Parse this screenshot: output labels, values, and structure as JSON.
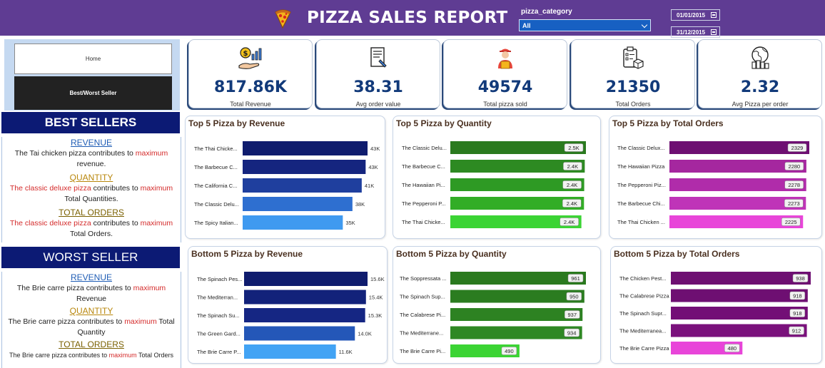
{
  "header": {
    "title": "PIZZA SALES REPORT",
    "category_label": "pizza_category",
    "category_value": "All",
    "date_start": "01/01/2015",
    "date_end": "31/12/2015",
    "bg_color": "#5f3c93"
  },
  "nav": {
    "home_label": "Home",
    "best_worst_label": "Best/Worst Seller"
  },
  "best": {
    "title": "BEST SELLERS",
    "revenue_head": "REVENUE",
    "revenue_pre": "The Tai chicken pizza contributes to ",
    "revenue_hl": "maximum",
    "revenue_post": " revenue.",
    "quantity_head": "QUANTITY",
    "quantity_name": "The classic deluxe pizza",
    "quantity_mid": " contributes to ",
    "quantity_hl": "maximum",
    "quantity_post": " Total Quantities.",
    "orders_head": "TOTAL ORDERS",
    "orders_name": "The classic deluxe pizza",
    "orders_mid": " contributes to ",
    "orders_hl": "maximum",
    "orders_post": " Total Orders."
  },
  "worst": {
    "title": "WORST SELLER",
    "revenue_head": "REVENUE",
    "revenue_pre": "The Brie carre pizza contributes to ",
    "revenue_hl": "maximum",
    "revenue_post": " Revenue",
    "quantity_head": "QUANTITY",
    "quantity_pre": "The Brie carre pizza contributes to ",
    "quantity_hl": "maximum",
    "quantity_post": " Total Quantity",
    "orders_head": "TOTAL ORDERS",
    "orders_pre": "The Brie carre pizza contributes to ",
    "orders_hl": "maximum",
    "orders_post": " Total Orders"
  },
  "kpis": [
    {
      "value": "817.86K",
      "label": "Total Revenue",
      "icon": "money-growth-icon"
    },
    {
      "value": "38.31",
      "label": "Avg order value",
      "icon": "receipt-icon"
    },
    {
      "value": "49574",
      "label": "Total pizza sold",
      "icon": "delivery-person-icon"
    },
    {
      "value": "21350",
      "label": "Total Orders",
      "icon": "clipboard-box-icon"
    },
    {
      "value": "2.32",
      "label": "Avg Pizza per order",
      "icon": "globe-money-icon"
    }
  ],
  "chart_data": [
    {
      "type": "bar",
      "orientation": "horizontal",
      "title": "Top 5 Pizza by Revenue",
      "categories": [
        "The Thai Chicke...",
        "The Barbecue C...",
        "The California C...",
        "The Classic Delu...",
        "The Spicy Italian..."
      ],
      "values": [
        43.43,
        42.77,
        41.41,
        38.18,
        34.83
      ],
      "labels": [
        "43K",
        "43K",
        "41K",
        "38K",
        "35K"
      ],
      "xlim": [
        0,
        43.43
      ],
      "colors": [
        "#0f1c6e",
        "#15257f",
        "#1f3f9e",
        "#2e6fd0",
        "#3f9af0"
      ]
    },
    {
      "type": "bar",
      "orientation": "horizontal",
      "title": "Top 5 Pizza by Quantity",
      "categories": [
        "The Classic Delu...",
        "The Barbecue C...",
        "The Hawaiian Pi...",
        "The Pepperoni P...",
        "The Thai Chicke..."
      ],
      "values": [
        2453,
        2432,
        2422,
        2418,
        2371
      ],
      "labels": [
        "2.5K",
        "2.4K",
        "2.4K",
        "2.4K",
        "2.4K"
      ],
      "xlim": [
        0,
        2453
      ],
      "colors": [
        "#2a7a1e",
        "#2d8a22",
        "#2e9a24",
        "#32ad26",
        "#3bd434"
      ]
    },
    {
      "type": "bar",
      "orientation": "horizontal",
      "title": "Top 5 Pizza by Total Orders",
      "categories": [
        "The Classic Delux...",
        "The Hawaiian Pizza",
        "The Pepperoni Piz...",
        "The Barbecue Chi...",
        "The Thai Chicken ..."
      ],
      "values": [
        2329,
        2280,
        2278,
        2273,
        2225
      ],
      "labels": [
        "2329",
        "2280",
        "2278",
        "2273",
        "2225"
      ],
      "xlim": [
        0,
        2329
      ],
      "colors": [
        "#6e0f72",
        "#a5279f",
        "#b02caa",
        "#bf34b8",
        "#e845d9"
      ]
    },
    {
      "type": "bar",
      "orientation": "horizontal",
      "title": "Bottom 5 Pizza by Revenue",
      "categories": [
        "The Spinach Pes...",
        "The Mediterran...",
        "The Spinach Su...",
        "The Green Gard...",
        "The Brie Carre P..."
      ],
      "values": [
        15.6,
        15.4,
        15.3,
        14.0,
        11.6
      ],
      "labels": [
        "15.6K",
        "15.4K",
        "15.3K",
        "14.0K",
        "11.6K"
      ],
      "xlim": [
        0,
        15.6
      ],
      "colors": [
        "#0f1c6e",
        "#12227a",
        "#152683",
        "#2457b8",
        "#42a3f4"
      ]
    },
    {
      "type": "bar",
      "orientation": "horizontal",
      "title": "Bottom 5 Pizza by Quantity",
      "categories": [
        "The Soppressata ...",
        "The Spinach Sup...",
        "The Calabrese Pi...",
        "The Mediterrane...",
        "The Brie Carre Pi..."
      ],
      "values": [
        961,
        950,
        937,
        934,
        490
      ],
      "labels": [
        "961",
        "950",
        "937",
        "934",
        "490"
      ],
      "xlim": [
        0,
        961
      ],
      "colors": [
        "#2a7a1e",
        "#2b7c20",
        "#2d8222",
        "#2f8824",
        "#3bd434"
      ]
    },
    {
      "type": "bar",
      "orientation": "horizontal",
      "title": "Bottom 5 Pizza by Total Orders",
      "categories": [
        "The Chicken Pest...",
        "The Calabrese Pizza",
        "The Spinach Supr...",
        "The Mediterranea...",
        "The Brie Carre Pizza"
      ],
      "values": [
        938,
        918,
        918,
        912,
        480
      ],
      "labels": [
        "938",
        "918",
        "918",
        "912",
        "480"
      ],
      "xlim": [
        0,
        938
      ],
      "colors": [
        "#6e0f72",
        "#6e0f72",
        "#730f76",
        "#7a117c",
        "#e845d9"
      ]
    }
  ]
}
